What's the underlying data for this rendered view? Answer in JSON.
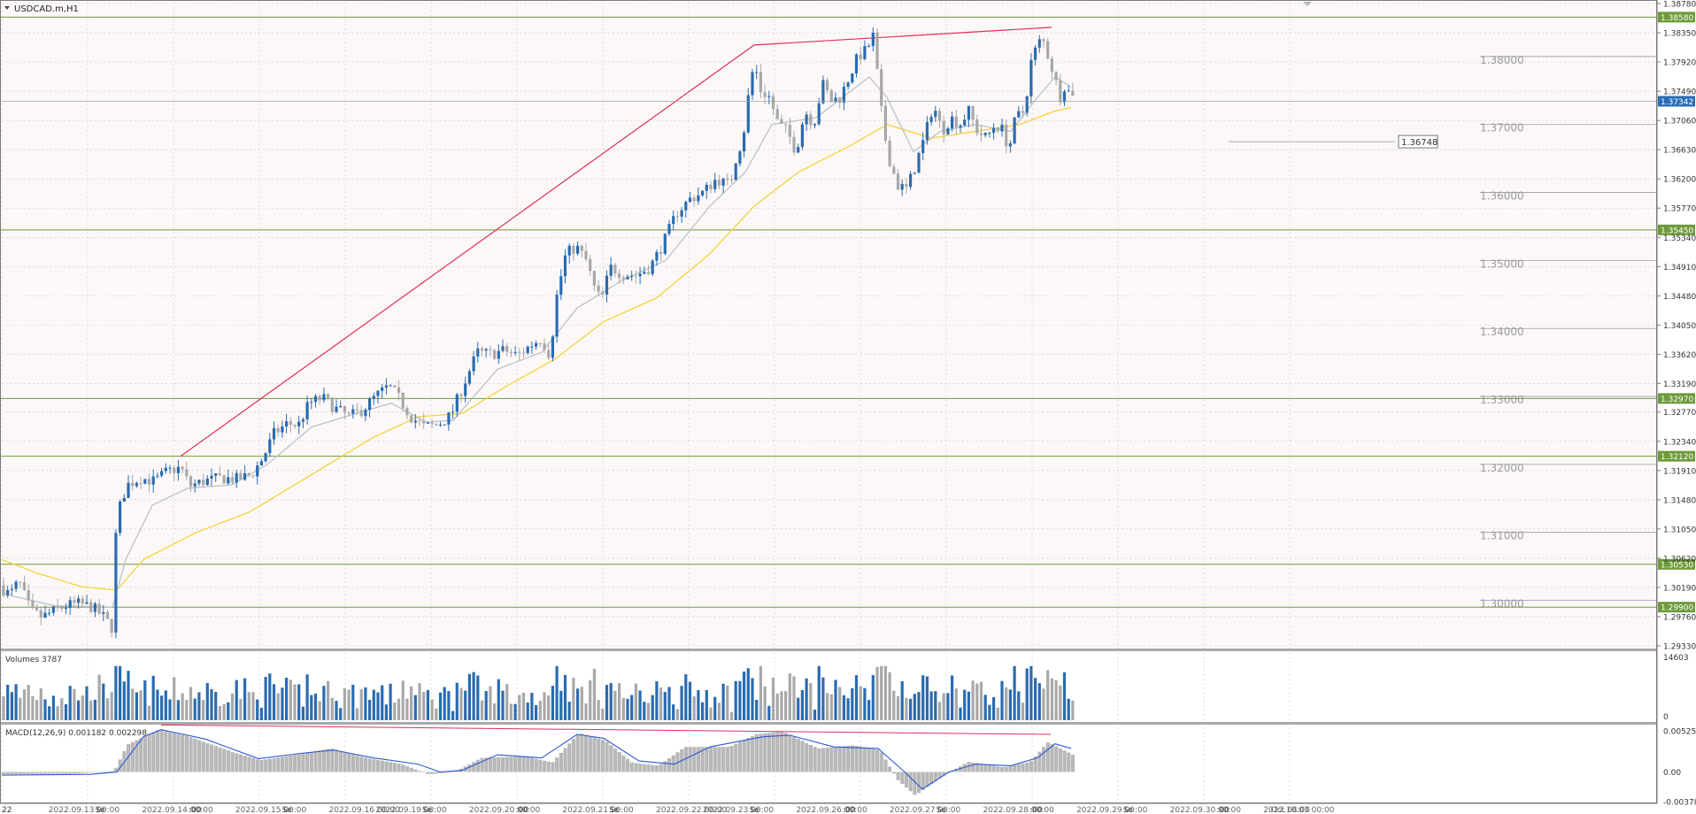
{
  "window": {
    "symbol_title": "USDCAD.m,H1",
    "menu_arrow_icon": "triangle-down-icon"
  },
  "colors": {
    "background": "#fdf8f8",
    "grid": "#c8c8c8",
    "bull_candle": "#2a6bb0",
    "bear_candle": "#a8a8a8",
    "ma_fast": "#b9c2c9",
    "ma_slow": "#f2d23c",
    "level_line": "#6e9a3a",
    "level_label_bg": "#6e9a3a",
    "trendline": "#e0305a",
    "round_level_line": "#9a9a9a",
    "macd_hist": "#b8b8b8",
    "macd_signal": "#2f55d0",
    "volume_bull": "#2a6bb0",
    "volume_bear": "#a8a8a8",
    "divergence_line": "#e0305a"
  },
  "chart_data": {
    "type": "candlestick",
    "symbol": "USDCAD.m",
    "timeframe": "H1",
    "price_axis": {
      "min": 1.2933,
      "max": 1.3878,
      "ticks": [
        "1.38780",
        "1.38350",
        "1.37920",
        "1.37490",
        "1.37060",
        "1.36630",
        "1.36200",
        "1.35770",
        "1.35340",
        "1.34910",
        "1.34480",
        "1.34050",
        "1.33620",
        "1.33190",
        "1.32770",
        "1.32340",
        "1.31910",
        "1.31480",
        "1.31050",
        "1.30620",
        "1.30190",
        "1.29760",
        "1.29330"
      ]
    },
    "current_price": {
      "value": 1.37342,
      "label": "1.37342"
    },
    "horizontal_levels": [
      {
        "value": 1.3858,
        "label": "1.38580"
      },
      {
        "value": 1.3545,
        "label": "1.35450"
      },
      {
        "value": 1.3297,
        "label": "1.32970"
      },
      {
        "value": 1.3212,
        "label": "1.32120"
      },
      {
        "value": 1.3053,
        "label": "1.30530"
      },
      {
        "value": 1.299,
        "label": "1.29900"
      }
    ],
    "round_levels": [
      {
        "value": 1.38,
        "label": "1.38000"
      },
      {
        "value": 1.37,
        "label": "1.37000"
      },
      {
        "value": 1.36,
        "label": "1.36000"
      },
      {
        "value": 1.35,
        "label": "1.35000"
      },
      {
        "value": 1.34,
        "label": "1.34000"
      },
      {
        "value": 1.33,
        "label": "1.33000"
      },
      {
        "value": 1.32,
        "label": "1.32000"
      },
      {
        "value": 1.31,
        "label": "1.31000"
      },
      {
        "value": 1.3,
        "label": "1.30000"
      }
    ],
    "price_marker": {
      "value": 1.36748,
      "label": "1.36748"
    },
    "x_axis_labels": [
      "22",
      "2022.09.13 00:00",
      "Se",
      "2022.09.14 00:00",
      ":00",
      "2022.09.15 00:00",
      "Se",
      "2022.09.16 00:00",
      "2022.09.19 00:00",
      "Se",
      "2022.09.20 00:00",
      ":00",
      "2022.09.21 00:00",
      "Se",
      "2022.09.22 00:00",
      "2022.09.23 00:00",
      "Se",
      "2022.09.26 00:00",
      ":00",
      "2022.09.27 00:00",
      "Se",
      "2022.09.28 00:00",
      ":00",
      "2022.09.29 00:00",
      "Se",
      "2022.09.30 00:00",
      ":00",
      "2022.10.03 00:00",
      "Oct 08:00"
    ],
    "close_path": [
      [
        0,
        1.3022
      ],
      [
        12,
        1.3008
      ],
      [
        22,
        1.3028
      ],
      [
        35,
        1.2985
      ],
      [
        48,
        1.2975
      ],
      [
        60,
        1.2983
      ],
      [
        75,
        1.2992
      ],
      [
        90,
        1.2995
      ],
      [
        105,
        1.299
      ],
      [
        118,
        1.2975
      ],
      [
        127,
        1.296
      ],
      [
        130,
        1.308
      ],
      [
        137,
        1.3145
      ],
      [
        145,
        1.317
      ],
      [
        160,
        1.318
      ],
      [
        175,
        1.3175
      ],
      [
        190,
        1.319
      ],
      [
        205,
        1.3195
      ],
      [
        215,
        1.3168
      ],
      [
        230,
        1.3175
      ],
      [
        250,
        1.318
      ],
      [
        270,
        1.3178
      ],
      [
        285,
        1.3185
      ],
      [
        298,
        1.321
      ],
      [
        310,
        1.3245
      ],
      [
        325,
        1.326
      ],
      [
        338,
        1.3258
      ],
      [
        350,
        1.329
      ],
      [
        365,
        1.3298
      ],
      [
        380,
        1.3282
      ],
      [
        395,
        1.327
      ],
      [
        410,
        1.328
      ],
      [
        425,
        1.33
      ],
      [
        440,
        1.3315
      ],
      [
        450,
        1.33
      ],
      [
        465,
        1.327
      ],
      [
        480,
        1.3255
      ],
      [
        495,
        1.3258
      ],
      [
        510,
        1.3272
      ],
      [
        522,
        1.331
      ],
      [
        540,
        1.3365
      ],
      [
        555,
        1.3362
      ],
      [
        570,
        1.3368
      ],
      [
        585,
        1.336
      ],
      [
        600,
        1.3375
      ],
      [
        612,
        1.3385
      ],
      [
        622,
        1.336
      ],
      [
        630,
        1.345
      ],
      [
        640,
        1.351
      ],
      [
        652,
        1.352
      ],
      [
        663,
        1.35
      ],
      [
        672,
        1.346
      ],
      [
        680,
        1.344
      ],
      [
        690,
        1.349
      ],
      [
        705,
        1.348
      ],
      [
        720,
        1.3478
      ],
      [
        735,
        1.349
      ],
      [
        750,
        1.3525
      ],
      [
        765,
        1.357
      ],
      [
        780,
        1.359
      ],
      [
        795,
        1.36
      ],
      [
        810,
        1.362
      ],
      [
        825,
        1.361
      ],
      [
        832,
        1.365
      ],
      [
        840,
        1.368
      ],
      [
        848,
        1.376
      ],
      [
        853,
        1.379
      ],
      [
        860,
        1.375
      ],
      [
        870,
        1.374
      ],
      [
        880,
        1.37
      ],
      [
        890,
        1.369
      ],
      [
        900,
        1.366
      ],
      [
        910,
        1.372
      ],
      [
        920,
        1.37
      ],
      [
        930,
        1.376
      ],
      [
        940,
        1.3735
      ],
      [
        950,
        1.374
      ],
      [
        960,
        1.377
      ],
      [
        970,
        1.38
      ],
      [
        980,
        1.381
      ],
      [
        987,
        1.383
      ],
      [
        993,
        1.376
      ],
      [
        998,
        1.37
      ],
      [
        1005,
        1.365
      ],
      [
        1015,
        1.361
      ],
      [
        1025,
        1.3605
      ],
      [
        1035,
        1.364
      ],
      [
        1045,
        1.368
      ],
      [
        1055,
        1.373
      ],
      [
        1065,
        1.369
      ],
      [
        1075,
        1.371
      ],
      [
        1085,
        1.37
      ],
      [
        1095,
        1.372
      ],
      [
        1105,
        1.369
      ],
      [
        1115,
        1.368
      ],
      [
        1125,
        1.37
      ],
      [
        1135,
        1.369
      ],
      [
        1140,
        1.366
      ],
      [
        1148,
        1.371
      ],
      [
        1158,
        1.372
      ],
      [
        1165,
        1.379
      ],
      [
        1172,
        1.3815
      ],
      [
        1178,
        1.3828
      ],
      [
        1185,
        1.38
      ],
      [
        1192,
        1.377
      ],
      [
        1198,
        1.374
      ],
      [
        1204,
        1.376
      ],
      [
        1208,
        1.3748
      ]
    ],
    "ma_fast_path": [
      [
        0,
        1.301
      ],
      [
        60,
        1.2992
      ],
      [
        125,
        1.299
      ],
      [
        140,
        1.306
      ],
      [
        170,
        1.314
      ],
      [
        210,
        1.3165
      ],
      [
        260,
        1.317
      ],
      [
        300,
        1.32
      ],
      [
        350,
        1.3255
      ],
      [
        400,
        1.3275
      ],
      [
        440,
        1.329
      ],
      [
        480,
        1.3262
      ],
      [
        510,
        1.3265
      ],
      [
        560,
        1.334
      ],
      [
        610,
        1.3365
      ],
      [
        650,
        1.343
      ],
      [
        700,
        1.347
      ],
      [
        750,
        1.35
      ],
      [
        800,
        1.358
      ],
      [
        840,
        1.363
      ],
      [
        870,
        1.37
      ],
      [
        920,
        1.371
      ],
      [
        980,
        1.377
      ],
      [
        1000,
        1.374
      ],
      [
        1030,
        1.366
      ],
      [
        1060,
        1.369
      ],
      [
        1100,
        1.37
      ],
      [
        1140,
        1.369
      ],
      [
        1170,
        1.374
      ],
      [
        1190,
        1.377
      ],
      [
        1208,
        1.3755
      ]
    ],
    "ma_slow_path": [
      [
        0,
        1.306
      ],
      [
        40,
        1.304
      ],
      [
        90,
        1.302
      ],
      [
        130,
        1.3015
      ],
      [
        160,
        1.306
      ],
      [
        220,
        1.31
      ],
      [
        280,
        1.313
      ],
      [
        350,
        1.3185
      ],
      [
        420,
        1.324
      ],
      [
        470,
        1.327
      ],
      [
        520,
        1.3275
      ],
      [
        570,
        1.3315
      ],
      [
        625,
        1.3355
      ],
      [
        680,
        1.341
      ],
      [
        740,
        1.3445
      ],
      [
        800,
        1.351
      ],
      [
        850,
        1.358
      ],
      [
        900,
        1.363
      ],
      [
        960,
        1.367
      ],
      [
        1000,
        1.37
      ],
      [
        1025,
        1.369
      ],
      [
        1050,
        1.368
      ],
      [
        1100,
        1.369
      ],
      [
        1150,
        1.37
      ],
      [
        1190,
        1.372
      ],
      [
        1208,
        1.3725
      ]
    ],
    "trendline_top": [
      [
        202,
        1.3212
      ],
      [
        850,
        1.3817
      ],
      [
        1186,
        1.3843
      ]
    ],
    "volumes": {
      "label": "Volumes 3787",
      "max_label": "14603",
      "zero_label": "0",
      "max": 14603
    },
    "macd": {
      "label": "MACD(12,26,9) 0.001182 0.002298",
      "ticks": [
        "0.005254",
        "0.00",
        "-0.003787"
      ],
      "max": 0.005254,
      "min": -0.003787,
      "hist_path": [
        [
          0,
          -0.0003
        ],
        [
          80,
          -0.0002
        ],
        [
          125,
          0.0001
        ],
        [
          140,
          0.0035
        ],
        [
          175,
          0.0054
        ],
        [
          210,
          0.0045
        ],
        [
          260,
          0.0025
        ],
        [
          290,
          0.0015
        ],
        [
          330,
          0.0022
        ],
        [
          370,
          0.003
        ],
        [
          410,
          0.0018
        ],
        [
          450,
          0.001
        ],
        [
          480,
          -0.0003
        ],
        [
          510,
          0.0
        ],
        [
          540,
          0.0018
        ],
        [
          590,
          0.002
        ],
        [
          620,
          0.0012
        ],
        [
          650,
          0.005
        ],
        [
          680,
          0.004
        ],
        [
          710,
          0.0012
        ],
        [
          740,
          0.0008
        ],
        [
          770,
          0.0032
        ],
        [
          820,
          0.0032
        ],
        [
          850,
          0.0048
        ],
        [
          880,
          0.0052
        ],
        [
          920,
          0.003
        ],
        [
          960,
          0.0034
        ],
        [
          990,
          0.0028
        ],
        [
          1010,
          -0.001
        ],
        [
          1030,
          -0.003
        ],
        [
          1060,
          -0.0006
        ],
        [
          1090,
          0.0013
        ],
        [
          1130,
          0.0006
        ],
        [
          1160,
          0.0013
        ],
        [
          1180,
          0.0038
        ],
        [
          1208,
          0.0022
        ]
      ],
      "signal_path": [
        [
          0,
          -0.0004
        ],
        [
          100,
          -0.0003
        ],
        [
          130,
          0.0
        ],
        [
          160,
          0.0045
        ],
        [
          180,
          0.0054
        ],
        [
          230,
          0.0042
        ],
        [
          290,
          0.0017
        ],
        [
          340,
          0.0024
        ],
        [
          375,
          0.0028
        ],
        [
          420,
          0.0018
        ],
        [
          470,
          0.001
        ],
        [
          495,
          0.0
        ],
        [
          520,
          0.0002
        ],
        [
          560,
          0.0022
        ],
        [
          610,
          0.0018
        ],
        [
          650,
          0.0048
        ],
        [
          680,
          0.0043
        ],
        [
          720,
          0.0014
        ],
        [
          760,
          0.001
        ],
        [
          800,
          0.0032
        ],
        [
          860,
          0.0045
        ],
        [
          890,
          0.0047
        ],
        [
          940,
          0.0032
        ],
        [
          990,
          0.003
        ],
        [
          1020,
          0.0
        ],
        [
          1040,
          -0.0022
        ],
        [
          1070,
          0.0
        ],
        [
          1100,
          0.001
        ],
        [
          1140,
          0.0008
        ],
        [
          1170,
          0.0018
        ],
        [
          1190,
          0.0036
        ],
        [
          1208,
          0.003
        ]
      ],
      "divergence_line": [
        [
          180,
          0.006
        ],
        [
          1185,
          0.0048
        ]
      ]
    }
  }
}
